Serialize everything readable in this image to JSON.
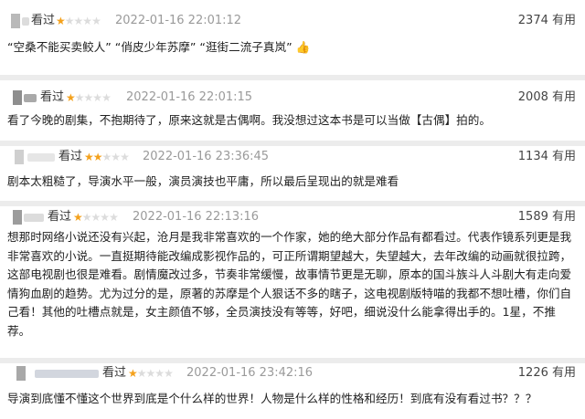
{
  "reviews": [
    {
      "seen_label": "看过",
      "stars": 1,
      "date": "2022-01-16 22:01:12",
      "useful_count": "2374 有用",
      "text": "“空桑不能买卖鲛人” “俏皮少年苏摩” “逛街二流子真岚” 👍"
    },
    {
      "seen_label": "看过",
      "stars": 1,
      "date": "2022-01-16 22:01:15",
      "useful_count": "2008 有用",
      "text": "看了今晚的剧集，不抱期待了，原来这就是古偶啊。我没想过这本书是可以当做【古偶】拍的。"
    },
    {
      "seen_label": "看过",
      "stars": 2,
      "date": "2022-01-16 23:36:45",
      "useful_count": "1134 有用",
      "text": "剧本太粗糙了，导演水平一般，演员演技也平庸，所以最后呈现出的就是难看"
    },
    {
      "seen_label": "看过",
      "stars": 1,
      "date": "2022-01-16 22:13:16",
      "useful_count": "1589 有用",
      "text": "想那时网络小说还没有兴起，沧月是我非常喜欢的一个作家，她的绝大部分作品有都看过。代表作镜系列更是我非常喜欢的小说。一直挺期待能改编成影视作品的，可正所谓期望越大，失望越大，去年改编的动画就很拉跨，这部电视剧也很是难看。剧情魔改过多，节奏非常缓慢，故事情节更是无聊，原本的国斗族斗人斗剧大有走向爱情狗血剧的趋势。尤为过分的是，原著的苏摩是个人狠话不多的瞎子，这电视剧版特喵的我都不想吐槽，你们自己看！其他的吐槽点就是，女主颜值不够，全员演技没有等等，好吧，细说没什么能拿得出手的。1星，不推荐。"
    },
    {
      "seen_label": "看过",
      "stars": 1,
      "date": "2022-01-16 23:42:16",
      "useful_count": "1226 有用",
      "text": "导演到底懂不懂这个世界到底是个什么样的世界！人物是什么样的性格和经历！到底有没有看过书？？？"
    }
  ],
  "star_on_color": "#f4a11c",
  "star_off_color": "#dcdcdc",
  "star_glyph": "★"
}
